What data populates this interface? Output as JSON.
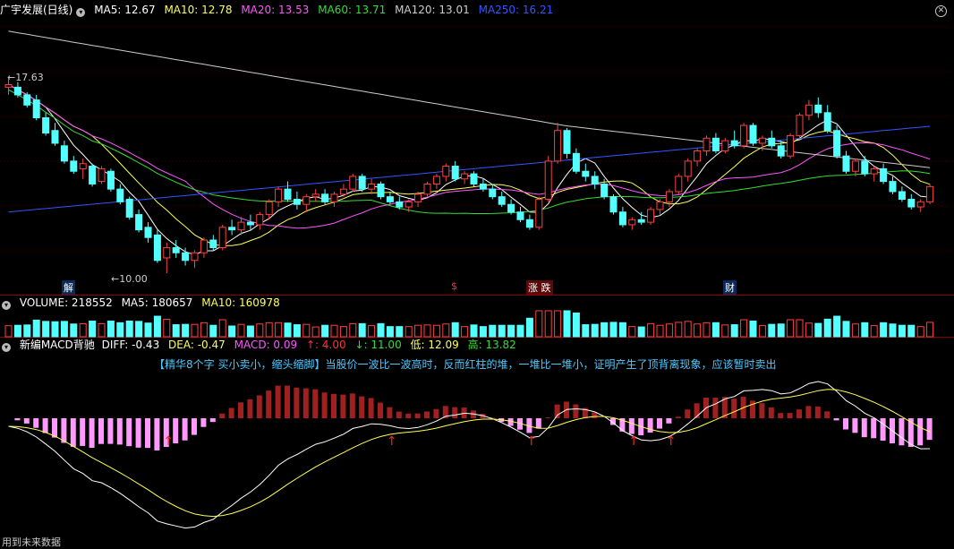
{
  "price_header": {
    "stock": "广宇发展(日线)",
    "ma5": "MA5: 12.67",
    "ma10": "MA10: 12.78",
    "ma20": "MA20: 13.53",
    "ma60": "MA60: 13.71",
    "ma120": "MA120: 13.01",
    "ma250": "MA250: 16.21"
  },
  "price_labels": {
    "max": "17.63",
    "min": "10.00"
  },
  "events": [
    "解",
    "$",
    "涨 跌",
    "财"
  ],
  "volume_header": {
    "volume": "VOLUME: 218552",
    "ma5": "MA5: 180657",
    "ma10": "MA10: 160978"
  },
  "macd_header": {
    "name": "新编MACD背驰",
    "diff": "DIFF: -0.43",
    "dea": "DEA: -0.47",
    "macd": "MACD: 0.09",
    "up": "↑: 4.00",
    "down": "↓: 11.00",
    "low": "低: 12.09",
    "high": "高: 13.82"
  },
  "macd_note": "【精华8个字 买小卖小，缩头缩脚】当股价一波比一波高时，反而红柱的堆，一堆比一堆小，证明产生了顶背离现象，应该暂时卖出",
  "footer": "用到未来数据",
  "colors": {
    "up": "#ff4040",
    "down": "#54ffff",
    "ma5": "#ffffff",
    "ma10": "#ffff55",
    "ma20": "#ff55ff",
    "ma60": "#33dd33",
    "ma120": "#cccccc",
    "ma250": "#3355ff",
    "macd_pos": "#a02020",
    "macd_neg": "#ff99ff",
    "macd_green": "#22ee88"
  },
  "chart_data": {
    "type": "candlestick",
    "price_range": [
      10.0,
      17.63
    ],
    "candles": [
      [
        17.3,
        17.63,
        17.0,
        17.4
      ],
      [
        17.3,
        17.5,
        16.9,
        17.0
      ],
      [
        17.0,
        17.1,
        16.5,
        16.6
      ],
      [
        16.8,
        17.0,
        16.0,
        16.1
      ],
      [
        16.1,
        16.3,
        15.4,
        15.5
      ],
      [
        15.6,
        15.9,
        15.0,
        15.1
      ],
      [
        15.0,
        15.2,
        14.3,
        14.4
      ],
      [
        14.4,
        14.6,
        13.9,
        14.0
      ],
      [
        14.1,
        14.5,
        13.7,
        14.3
      ],
      [
        14.2,
        14.3,
        13.4,
        13.5
      ],
      [
        13.6,
        14.2,
        13.5,
        14.1
      ],
      [
        14.0,
        14.1,
        13.2,
        13.3
      ],
      [
        13.3,
        13.5,
        12.7,
        12.8
      ],
      [
        12.9,
        13.0,
        12.1,
        12.2
      ],
      [
        12.3,
        12.5,
        11.6,
        11.7
      ],
      [
        11.8,
        12.0,
        11.2,
        11.4
      ],
      [
        11.5,
        11.7,
        10.4,
        10.5
      ],
      [
        10.6,
        11.2,
        10.0,
        11.0
      ],
      [
        11.0,
        11.3,
        10.6,
        10.8
      ],
      [
        10.8,
        11.0,
        10.3,
        10.5
      ],
      [
        10.5,
        10.9,
        10.2,
        10.8
      ],
      [
        10.8,
        11.4,
        10.6,
        11.3
      ],
      [
        11.3,
        11.5,
        10.9,
        11.0
      ],
      [
        11.0,
        11.9,
        10.9,
        11.8
      ],
      [
        11.8,
        12.1,
        11.5,
        11.7
      ],
      [
        11.7,
        12.2,
        11.5,
        12.0
      ],
      [
        12.0,
        12.3,
        11.7,
        11.9
      ],
      [
        11.9,
        12.4,
        11.7,
        12.3
      ],
      [
        12.3,
        12.9,
        12.1,
        12.8
      ],
      [
        12.8,
        13.4,
        12.6,
        13.3
      ],
      [
        13.3,
        13.6,
        12.8,
        12.9
      ],
      [
        12.9,
        13.2,
        12.5,
        12.7
      ],
      [
        12.7,
        13.1,
        12.4,
        13.0
      ],
      [
        13.0,
        13.3,
        12.8,
        13.1
      ],
      [
        13.1,
        13.3,
        12.7,
        12.8
      ],
      [
        12.8,
        13.2,
        12.6,
        13.1
      ],
      [
        13.1,
        13.5,
        13.0,
        13.3
      ],
      [
        13.3,
        13.9,
        13.2,
        13.8
      ],
      [
        13.8,
        13.9,
        13.2,
        13.3
      ],
      [
        13.3,
        13.7,
        13.1,
        13.5
      ],
      [
        13.5,
        13.6,
        12.9,
        13.0
      ],
      [
        13.0,
        13.2,
        12.7,
        12.8
      ],
      [
        12.8,
        13.0,
        12.5,
        12.6
      ],
      [
        12.6,
        12.9,
        12.4,
        12.8
      ],
      [
        12.8,
        13.2,
        12.6,
        13.1
      ],
      [
        13.1,
        13.6,
        13.0,
        13.5
      ],
      [
        13.5,
        13.9,
        13.3,
        13.8
      ],
      [
        13.8,
        14.3,
        13.6,
        14.2
      ],
      [
        14.2,
        14.4,
        13.6,
        13.7
      ],
      [
        13.7,
        14.0,
        13.5,
        13.9
      ],
      [
        13.9,
        14.0,
        13.4,
        13.5
      ],
      [
        13.5,
        13.7,
        13.2,
        13.3
      ],
      [
        13.3,
        13.5,
        12.9,
        13.0
      ],
      [
        13.0,
        13.2,
        12.6,
        12.7
      ],
      [
        12.7,
        12.9,
        12.3,
        12.4
      ],
      [
        12.4,
        12.6,
        12.0,
        12.1
      ],
      [
        12.1,
        12.3,
        11.7,
        11.8
      ],
      [
        11.8,
        13.0,
        11.7,
        12.9
      ],
      [
        12.9,
        14.6,
        12.8,
        14.4
      ],
      [
        14.4,
        15.9,
        14.3,
        15.6
      ],
      [
        15.6,
        15.7,
        14.5,
        14.7
      ],
      [
        14.7,
        14.9,
        13.9,
        14.0
      ],
      [
        14.0,
        14.3,
        13.6,
        13.8
      ],
      [
        13.8,
        14.0,
        13.3,
        13.5
      ],
      [
        13.5,
        13.7,
        12.9,
        13.0
      ],
      [
        13.0,
        13.1,
        12.3,
        12.4
      ],
      [
        12.4,
        12.6,
        11.8,
        11.9
      ],
      [
        11.9,
        12.2,
        11.7,
        12.1
      ],
      [
        12.1,
        12.4,
        11.9,
        12.0
      ],
      [
        12.0,
        12.6,
        11.9,
        12.5
      ],
      [
        12.5,
        12.9,
        12.3,
        12.8
      ],
      [
        12.8,
        13.3,
        12.6,
        13.2
      ],
      [
        13.2,
        13.9,
        13.1,
        13.8
      ],
      [
        13.8,
        14.5,
        13.6,
        14.4
      ],
      [
        14.4,
        14.9,
        14.2,
        14.8
      ],
      [
        14.8,
        15.4,
        14.6,
        15.3
      ],
      [
        15.3,
        15.5,
        14.7,
        14.8
      ],
      [
        14.8,
        15.3,
        14.7,
        15.2
      ],
      [
        15.2,
        15.6,
        14.9,
        15.0
      ],
      [
        15.0,
        15.9,
        14.9,
        15.8
      ],
      [
        15.8,
        15.9,
        15.0,
        15.1
      ],
      [
        15.1,
        15.4,
        14.8,
        15.3
      ],
      [
        15.3,
        15.6,
        14.9,
        15.0
      ],
      [
        15.0,
        15.2,
        14.5,
        14.6
      ],
      [
        14.6,
        15.5,
        14.5,
        15.4
      ],
      [
        15.4,
        16.3,
        15.3,
        16.2
      ],
      [
        16.2,
        16.8,
        16.0,
        16.6
      ],
      [
        16.6,
        16.9,
        16.1,
        16.3
      ],
      [
        16.3,
        16.6,
        15.5,
        15.6
      ],
      [
        15.6,
        15.8,
        14.5,
        14.6
      ],
      [
        14.6,
        14.8,
        13.9,
        14.0
      ],
      [
        14.0,
        14.5,
        13.8,
        14.4
      ],
      [
        14.4,
        14.6,
        13.8,
        13.9
      ],
      [
        13.9,
        14.2,
        13.6,
        14.1
      ],
      [
        14.1,
        14.3,
        13.5,
        13.6
      ],
      [
        13.6,
        13.8,
        13.1,
        13.2
      ],
      [
        13.2,
        13.4,
        12.8,
        12.9
      ],
      [
        12.9,
        13.1,
        12.5,
        12.6
      ],
      [
        12.6,
        12.9,
        12.4,
        12.8
      ],
      [
        12.8,
        13.5,
        12.7,
        13.4
      ]
    ],
    "volume_range": [
      0,
      220000
    ]
  }
}
